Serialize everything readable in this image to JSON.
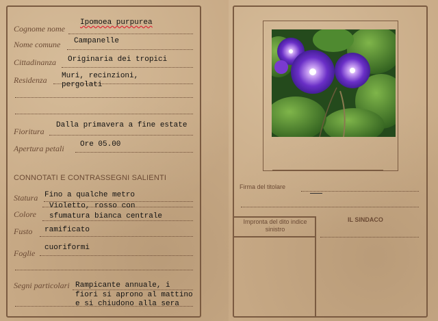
{
  "left": {
    "fields": [
      {
        "label": "Cognome nome",
        "value": "Ipomoea purpurea"
      },
      {
        "label": "Nome comune",
        "value": "Campanelle"
      },
      {
        "label": "Cittadinanza",
        "value": "Originaria dei tropici"
      },
      {
        "label": "Residenza",
        "value_lines": [
          "Muri, recinzioni,",
          "pergolati"
        ]
      },
      {
        "label": "Fioritura",
        "value": "Dalla primavera a fine estate"
      },
      {
        "label": "Apertura petali",
        "value": "Ore 05.00"
      }
    ],
    "section_title": "CONNOTATI E CONTRASSEGNI SALIENTI",
    "traits": [
      {
        "label": "Statura",
        "value": "Fino a qualche metro"
      },
      {
        "label": "Colore",
        "value_lines": [
          "Violetto, rosso con",
          "sfumatura bianca centrale"
        ]
      },
      {
        "label": "Fusto",
        "value": "ramificato"
      },
      {
        "label": "Foglie",
        "value": "cuoriformi"
      },
      {
        "label": "Segni particolari",
        "value_lines": [
          "Rampicante annuale, i",
          "fiori si aprono al mattino",
          "e si chiudono alla sera"
        ]
      }
    ]
  },
  "right": {
    "photo": {
      "subject": "purple morning glory flowers",
      "colors": {
        "petal": "#6a2fc7",
        "leaf": "#3f7a2a",
        "center": "#f4e8ff"
      }
    },
    "signature_label": "Firma del titolare",
    "fingerprint_label": "Impronta del dito indice sinistro",
    "mayor_label": "IL SINDACO"
  },
  "colors": {
    "paper": "#c8aa86",
    "ink_brown": "#6b4a34",
    "frame": "#7a5a40",
    "typed_ink": "#111111"
  }
}
